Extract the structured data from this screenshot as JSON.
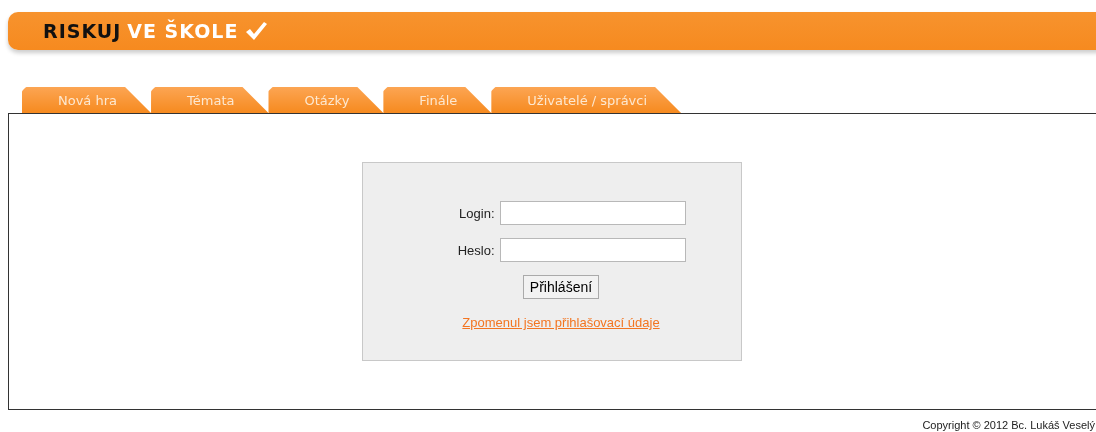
{
  "logo": {
    "dark": "RISKUJ",
    "light": "VE ŠKOLE"
  },
  "tabs": [
    {
      "label": "Nová hra"
    },
    {
      "label": "Témata"
    },
    {
      "label": "Otázky"
    },
    {
      "label": "Finále"
    },
    {
      "label": "Uživatelé / správci"
    }
  ],
  "login_form": {
    "fields": [
      {
        "label": "Login:"
      },
      {
        "label": "Heslo:"
      }
    ],
    "submit": "Přihlášení",
    "forgot_link": "Zpomenul jsem přihlašovací údaje"
  },
  "footer": "Copyright © 2012 Bc. Lukáš Veselý"
}
